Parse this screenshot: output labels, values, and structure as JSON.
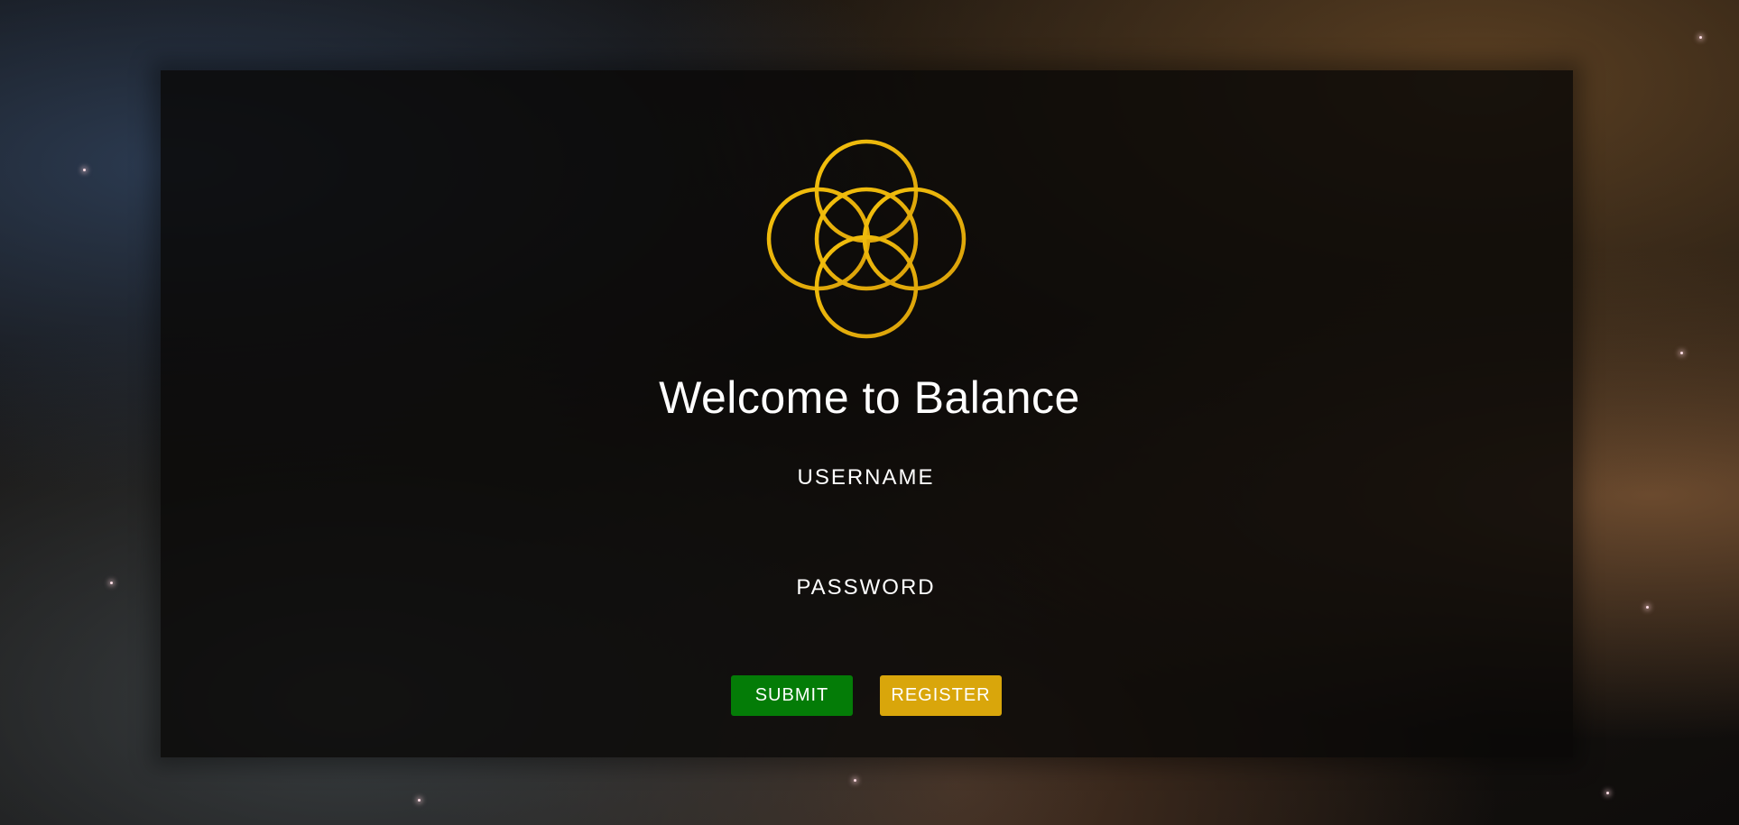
{
  "page": {
    "title": "Welcome to Balance"
  },
  "form": {
    "username_label": "USERNAME",
    "username_value": "",
    "password_label": "PASSWORD",
    "password_value": ""
  },
  "buttons": {
    "submit_label": "SUBMIT",
    "register_label": "REGISTER"
  },
  "icons": {
    "logo": "five-interlocking-rings-logo"
  },
  "colors": {
    "logo_gold": "#e8b90c",
    "submit_green": "#047c07",
    "register_gold": "#d9a60b",
    "text": "#ffffff"
  }
}
